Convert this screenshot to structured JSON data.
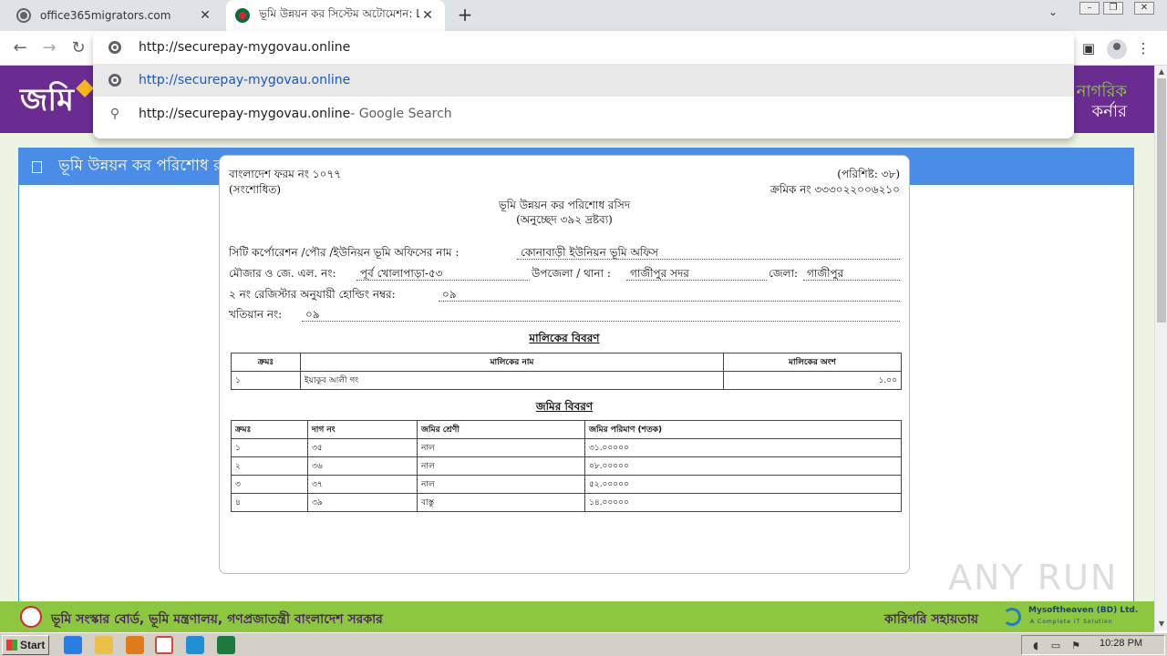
{
  "browser": {
    "tabs": [
      {
        "label": "office365migrators.com"
      },
      {
        "label": "ভূমি উন্নয়ন কর সিস্টেম অটোমেশন: Ldtax"
      }
    ],
    "address": "http://securepay-mygovau.online",
    "suggestions": [
      {
        "text": "http://securepay-mygovau.online",
        "suffix": ""
      },
      {
        "text": "http://securepay-mygovau.online",
        "suffix": " - Google Search"
      }
    ]
  },
  "site": {
    "logo_text": "জমি",
    "corner_line1": "নাগরিক",
    "corner_line2": "কর্নার",
    "panel_title": "ভূমি উন্নয়ন কর পরিশোধ রসিদ"
  },
  "receipt": {
    "form_no": "বাংলাদেশ ফরম নং ১০৭৭",
    "revised": "(সংশোধিত)",
    "appendix": "(পরিশিষ্ট: ৩৮)",
    "serial": "ক্রমিক নং ৩৩৩০২২০০৬২১০",
    "title": "ভূমি উন্নয়ন কর পরিশোধ রসিদ",
    "subtitle": "(অনুচ্ছেদ ৩৯২ দ্রষ্টব্য)",
    "office_label": "সিটি কর্পোরেশন /পৌর /ইউনিয়ন ভূমি অফিসের নাম :",
    "office_value": "কোনাবাড়ী ইউনিয়ন ভূমি অফিস",
    "mouza_label": "মৌজার ও জে. এল. নং:",
    "mouza_value": "পূর্ব খোলাপাড়া-৫৩",
    "upazila_label": "উপজেলা / থানা :",
    "upazila_value": "গাজীপুর সদর",
    "district_label": "জেলা:",
    "district_value": "গাজীপুর",
    "holding_label": "২ নং রেজিস্টার অনুযায়ী হোল্ডিং নম্বর:",
    "holding_value": "০৯",
    "khatian_label": "খতিয়ান নং:",
    "khatian_value": "০৯",
    "owner_heading": "মালিকের বিবরণ",
    "owner_cols": [
      "ক্রমঃ",
      "মালিকের নাম",
      "মালিকের অংশ"
    ],
    "owner_rows": [
      [
        "১",
        "ইয়াকুব আলী গং",
        "১.০০"
      ]
    ],
    "land_heading": "জমির বিবরণ",
    "land_cols": [
      "ক্রমঃ",
      "দাগ নং",
      "জমির শ্রেণী",
      "জমির পরিমাণ (শতক)"
    ],
    "land_rows": [
      [
        "১",
        "৩৫",
        "নাল",
        "৩১.০০০০০"
      ],
      [
        "২",
        "৩৬",
        "নাল",
        "০৮.০০০০০"
      ],
      [
        "৩",
        "৩৭",
        "নাল",
        "৫২.০০০০০"
      ],
      [
        "৪",
        "৩৯",
        "বাস্তু",
        "১৪.০০০০০"
      ]
    ]
  },
  "footer": {
    "text": "ভূমি সংস্কার বোর্ড, ভূমি মন্ত্রণালয়, গণপ্রজাতন্ত্রী বাংলাদেশ সরকার",
    "tech_label": "কারিগরি সহায়তায়",
    "company": "Mysoftheaven (BD) Ltd.",
    "tagline": "A Complete IT Solution"
  },
  "watermark": "ANY RUN",
  "taskbar": {
    "start_label": "Start",
    "clock": "10:28 PM"
  },
  "icons": [
    "globe-icon",
    "search-icon",
    "back-icon",
    "forward-icon",
    "reload-icon",
    "close-icon",
    "plus-icon",
    "chevron-down-icon",
    "sidebar-icon",
    "profile-icon",
    "checkbox-icon"
  ]
}
